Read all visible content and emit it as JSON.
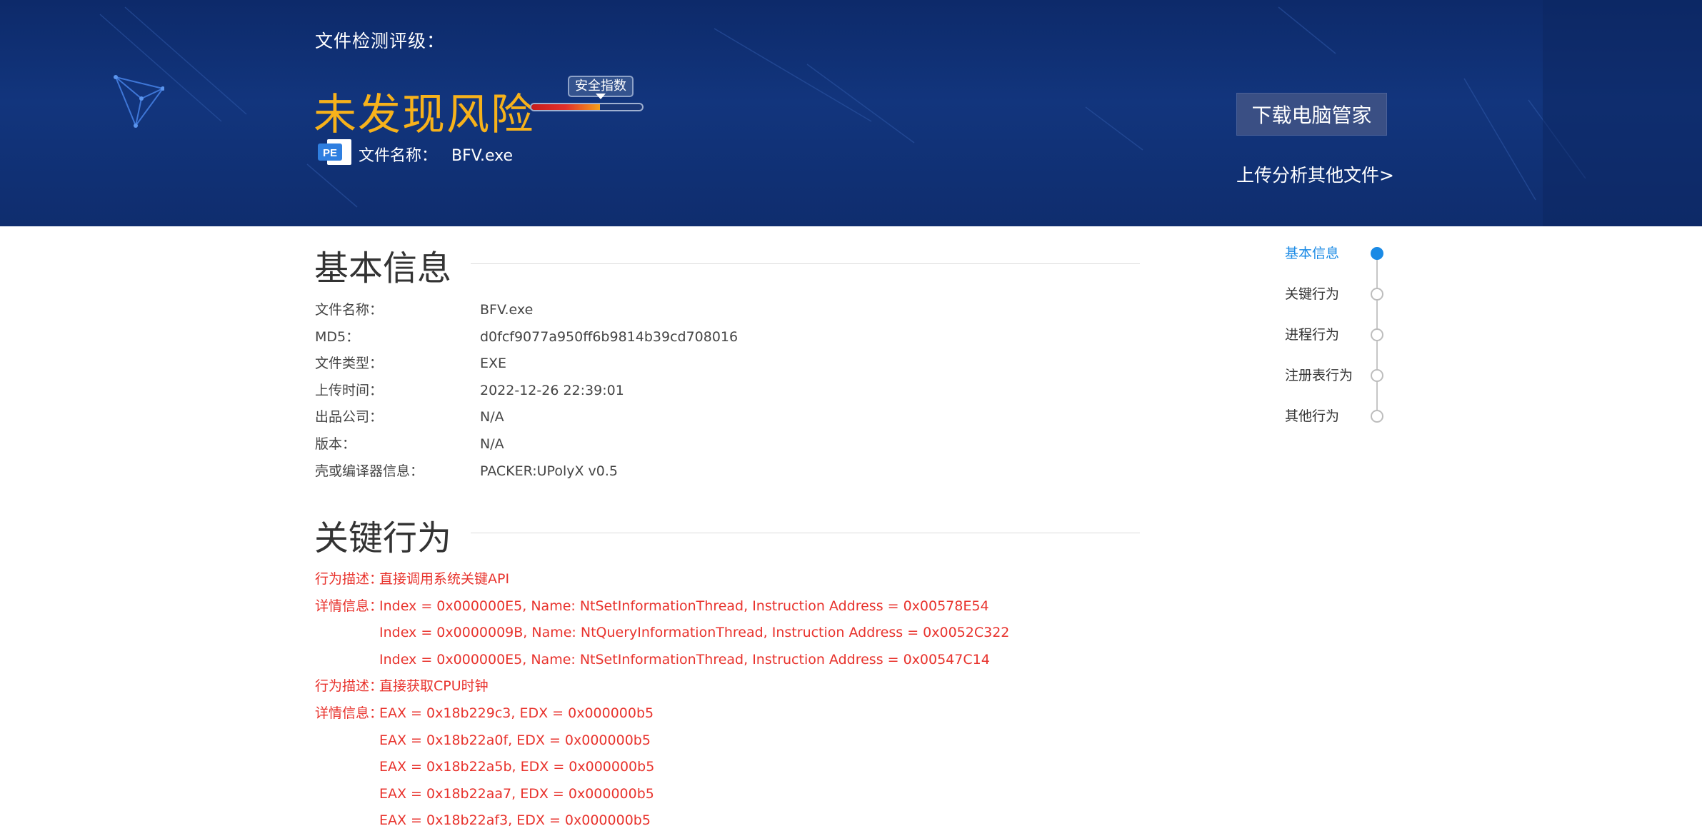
{
  "header": {
    "rating_label": "文件检测评级：",
    "risk_result": "未发现风险",
    "score_badge": "安全指数",
    "score_level": 0.62,
    "file_name_label": "文件名称：",
    "file_name_value": "BFV.exe",
    "pe_icon_text": "PE",
    "download_button": "下载电脑管家",
    "upload_link": "上传分析其他文件>"
  },
  "basic_info": {
    "title": "基本信息",
    "rows": [
      {
        "label": "文件名称：",
        "value": "BFV.exe"
      },
      {
        "label": "MD5：",
        "value": "d0fcf9077a950ff6b9814b39cd708016"
      },
      {
        "label": "文件类型：",
        "value": "EXE"
      },
      {
        "label": "上传时间：",
        "value": "2022-12-26 22:39:01"
      },
      {
        "label": "出品公司：",
        "value": "N/A"
      },
      {
        "label": "版本：",
        "value": "N/A"
      },
      {
        "label": "壳或编译器信息：",
        "value": "PACKER:UPolyX v0.5"
      }
    ]
  },
  "key_behavior": {
    "title": "关键行为",
    "rows": [
      {
        "label": "行为描述：",
        "value": "直接调用系统关键API"
      },
      {
        "label": "详情信息：",
        "value": "Index = 0x000000E5, Name: NtSetInformationThread, Instruction Address = 0x00578E54"
      },
      {
        "label": "",
        "value": "Index = 0x0000009B, Name: NtQueryInformationThread, Instruction Address = 0x0052C322"
      },
      {
        "label": "",
        "value": "Index = 0x000000E5, Name: NtSetInformationThread, Instruction Address = 0x00547C14"
      },
      {
        "label": "行为描述：",
        "value": "直接获取CPU时钟"
      },
      {
        "label": "详情信息：",
        "value": "EAX = 0x18b229c3, EDX = 0x000000b5"
      },
      {
        "label": "",
        "value": "EAX = 0x18b22a0f, EDX = 0x000000b5"
      },
      {
        "label": "",
        "value": "EAX = 0x18b22a5b, EDX = 0x000000b5"
      },
      {
        "label": "",
        "value": "EAX = 0x18b22aa7, EDX = 0x000000b5"
      },
      {
        "label": "",
        "value": "EAX = 0x18b22af3, EDX = 0x000000b5"
      }
    ]
  },
  "side_nav": {
    "items": [
      {
        "label": "基本信息",
        "active": true
      },
      {
        "label": "关键行为",
        "active": false
      },
      {
        "label": "进程行为",
        "active": false
      },
      {
        "label": "注册表行为",
        "active": false
      },
      {
        "label": "其他行为",
        "active": false
      }
    ]
  },
  "colors": {
    "banner": "#12357d",
    "risk_text": "#f7b21b",
    "alert_text": "#e8322c",
    "nav_active": "#1a8ae5"
  }
}
